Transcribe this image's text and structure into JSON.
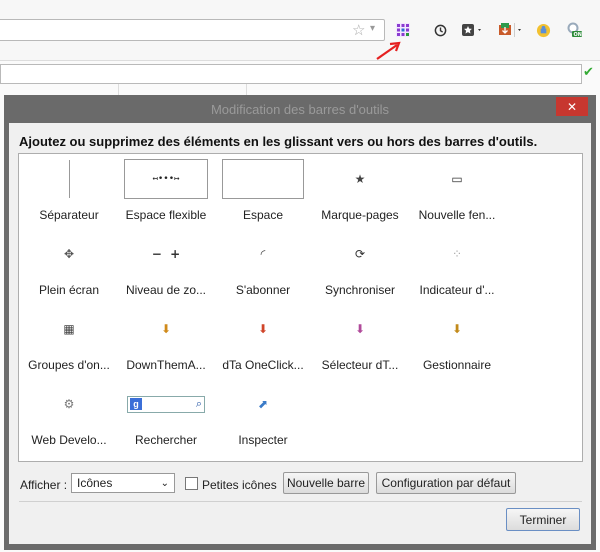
{
  "dialog": {
    "title": "Modification des barres d'outils",
    "instructions": "Ajoutez ou supprimez des éléments en les glissant vers ou hors des barres d'outils."
  },
  "palette": {
    "items": [
      {
        "label": "Séparateur",
        "icon": "separator-icon"
      },
      {
        "label": "Espace flexible",
        "icon": "flexible-space-icon",
        "glyph": "↤•••↦"
      },
      {
        "label": "Espace",
        "icon": "space-icon"
      },
      {
        "label": "Marque-pages",
        "icon": "bookmarks-icon",
        "glyph": "★"
      },
      {
        "label": "Nouvelle fen...",
        "icon": "new-window-icon",
        "glyph": "▭"
      },
      {
        "label": "Plein écran",
        "icon": "fullscreen-icon",
        "glyph": "✥"
      },
      {
        "label": "Niveau de zo...",
        "icon": "zoom-icon",
        "glyph": "−  +"
      },
      {
        "label": "S'abonner",
        "icon": "rss-icon",
        "glyph": "◜"
      },
      {
        "label": "Synchroniser",
        "icon": "sync-icon",
        "glyph": "⟳"
      },
      {
        "label": "Indicateur d'...",
        "icon": "loading-indicator-icon",
        "glyph": "⁘"
      },
      {
        "label": "Groupes d'on...",
        "icon": "tab-groups-icon",
        "glyph": "▦"
      },
      {
        "label": "DownThemA...",
        "icon": "downthemall-icon",
        "glyph": "⬇"
      },
      {
        "label": "dTa OneClick...",
        "icon": "dta-oneclick-icon",
        "glyph": "⬇"
      },
      {
        "label": "Sélecteur dT...",
        "icon": "dta-selector-icon",
        "glyph": "⬇"
      },
      {
        "label": "Gestionnaire",
        "icon": "manager-icon",
        "glyph": "⬇"
      },
      {
        "label": "Web Develo...",
        "icon": "web-developer-icon",
        "glyph": "⚙"
      },
      {
        "label": "Rechercher",
        "icon": "search-box-icon",
        "glyph": "g"
      },
      {
        "label": "Inspecter",
        "icon": "inspect-icon",
        "glyph": "⬈"
      }
    ]
  },
  "footer": {
    "show_label": "Afficher :",
    "show_value": "Icônes",
    "small_icons_label": "Petites icônes",
    "new_bar_label": "Nouvelle barre",
    "default_config_label": "Configuration par défaut",
    "done_label": "Terminer"
  },
  "colors": {
    "close_button": "#c7372f",
    "annotation_arrow": "#e52020",
    "check": "#33aa33"
  }
}
